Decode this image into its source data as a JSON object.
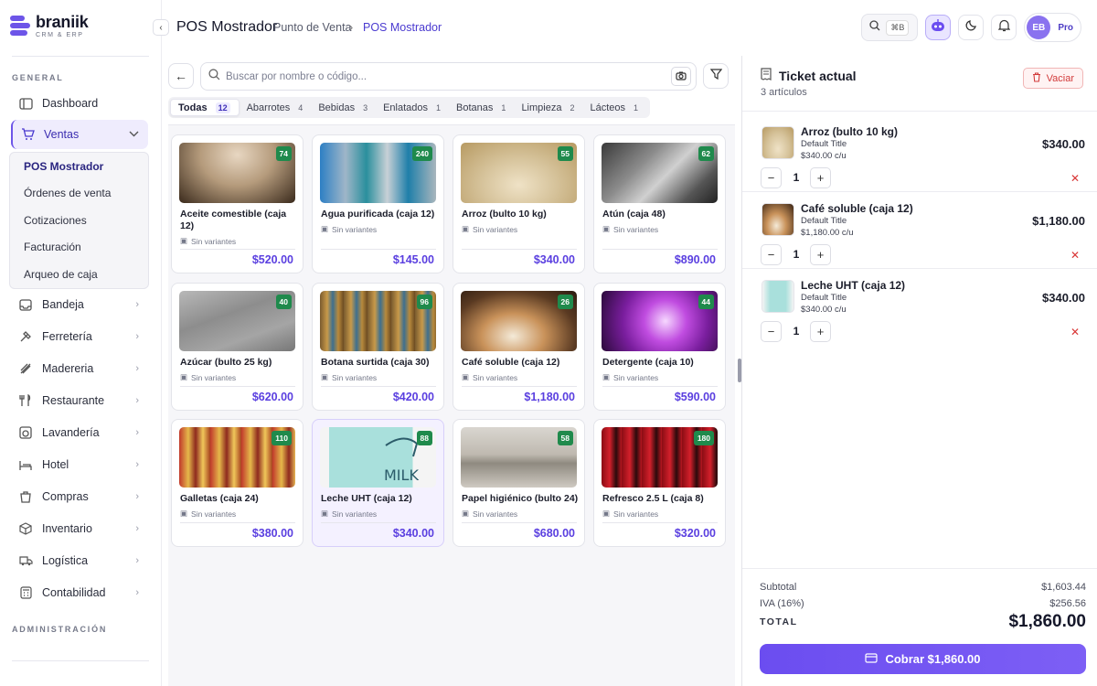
{
  "brand": {
    "name": "braniik",
    "subtitle": "CRM & ERP"
  },
  "sidebar": {
    "section_general": "GENERAL",
    "section_admin": "ADMINISTRACIÓN",
    "items": [
      {
        "label": "Dashboard",
        "icon": "dashboard-icon"
      },
      {
        "label": "Ventas",
        "icon": "cart-icon"
      },
      {
        "label": "Bandeja",
        "icon": "inbox-icon"
      },
      {
        "label": "Ferretería",
        "icon": "hammer-icon"
      },
      {
        "label": "Madereria",
        "icon": "wood-icon"
      },
      {
        "label": "Restaurante",
        "icon": "restaurant-icon"
      },
      {
        "label": "Lavandería",
        "icon": "laundry-icon"
      },
      {
        "label": "Hotel",
        "icon": "hotel-icon"
      },
      {
        "label": "Compras",
        "icon": "purchases-icon"
      },
      {
        "label": "Inventario",
        "icon": "inventory-icon"
      },
      {
        "label": "Logística",
        "icon": "truck-icon"
      },
      {
        "label": "Contabilidad",
        "icon": "calculator-icon"
      }
    ],
    "ventas_sub": [
      "POS Mostrador",
      "Órdenes de venta",
      "Cotizaciones",
      "Facturación",
      "Arqueo de caja"
    ]
  },
  "header": {
    "title": "POS Mostrador",
    "breadcrumb": [
      "Punto de Venta",
      "POS Mostrador"
    ],
    "shortcut": "⌘B",
    "avatar_initials": "EB",
    "plan": "Pro"
  },
  "search": {
    "placeholder": "Buscar por nombre o código..."
  },
  "tabs": [
    {
      "label": "Todas",
      "count": "12"
    },
    {
      "label": "Abarrotes",
      "count": "4"
    },
    {
      "label": "Bebidas",
      "count": "3"
    },
    {
      "label": "Enlatados",
      "count": "1"
    },
    {
      "label": "Botanas",
      "count": "1"
    },
    {
      "label": "Limpieza",
      "count": "2"
    },
    {
      "label": "Lácteos",
      "count": "1"
    }
  ],
  "variant_label": "Sin variantes",
  "products": [
    {
      "name": "Aceite comestible (caja 12)",
      "stock": "74",
      "price": "$520.00"
    },
    {
      "name": "Agua purificada (caja 12)",
      "stock": "240",
      "price": "$145.00"
    },
    {
      "name": "Arroz (bulto 10 kg)",
      "stock": "55",
      "price": "$340.00"
    },
    {
      "name": "Atún (caja 48)",
      "stock": "62",
      "price": "$890.00"
    },
    {
      "name": "Azúcar (bulto 25 kg)",
      "stock": "40",
      "price": "$620.00"
    },
    {
      "name": "Botana surtida (caja 30)",
      "stock": "96",
      "price": "$420.00"
    },
    {
      "name": "Café soluble (caja 12)",
      "stock": "26",
      "price": "$1,180.00"
    },
    {
      "name": "Detergente (caja 10)",
      "stock": "44",
      "price": "$590.00"
    },
    {
      "name": "Galletas (caja 24)",
      "stock": "110",
      "price": "$380.00"
    },
    {
      "name": "Leche UHT (caja 12)",
      "stock": "88",
      "price": "$340.00"
    },
    {
      "name": "Papel higiénico (bulto 24)",
      "stock": "58",
      "price": "$680.00"
    },
    {
      "name": "Refresco 2.5 L (caja 8)",
      "stock": "180",
      "price": "$320.00"
    }
  ],
  "ticket": {
    "title": "Ticket actual",
    "count": "3 artículos",
    "clear_label": "Vaciar",
    "lines": [
      {
        "name": "Arroz (bulto 10 kg)",
        "variant": "Default Title",
        "unit": "$340.00 c/u",
        "qty": "1",
        "total": "$340.00"
      },
      {
        "name": "Café soluble (caja 12)",
        "variant": "Default Title",
        "unit": "$1,180.00 c/u",
        "qty": "1",
        "total": "$1,180.00"
      },
      {
        "name": "Leche UHT (caja 12)",
        "variant": "Default Title",
        "unit": "$340.00 c/u",
        "qty": "1",
        "total": "$340.00"
      }
    ],
    "subtotal_label": "Subtotal",
    "subtotal": "$1,603.44",
    "iva_label": "IVA (16%)",
    "iva": "$256.56",
    "total_label": "TOTAL",
    "total": "$1,860.00",
    "checkout_label": "Cobrar $1,860.00"
  },
  "colors": {
    "accent": "#6d55e8",
    "price": "#5a3fe0",
    "stock_badge": "#1f8a4c",
    "danger": "#d93636"
  }
}
